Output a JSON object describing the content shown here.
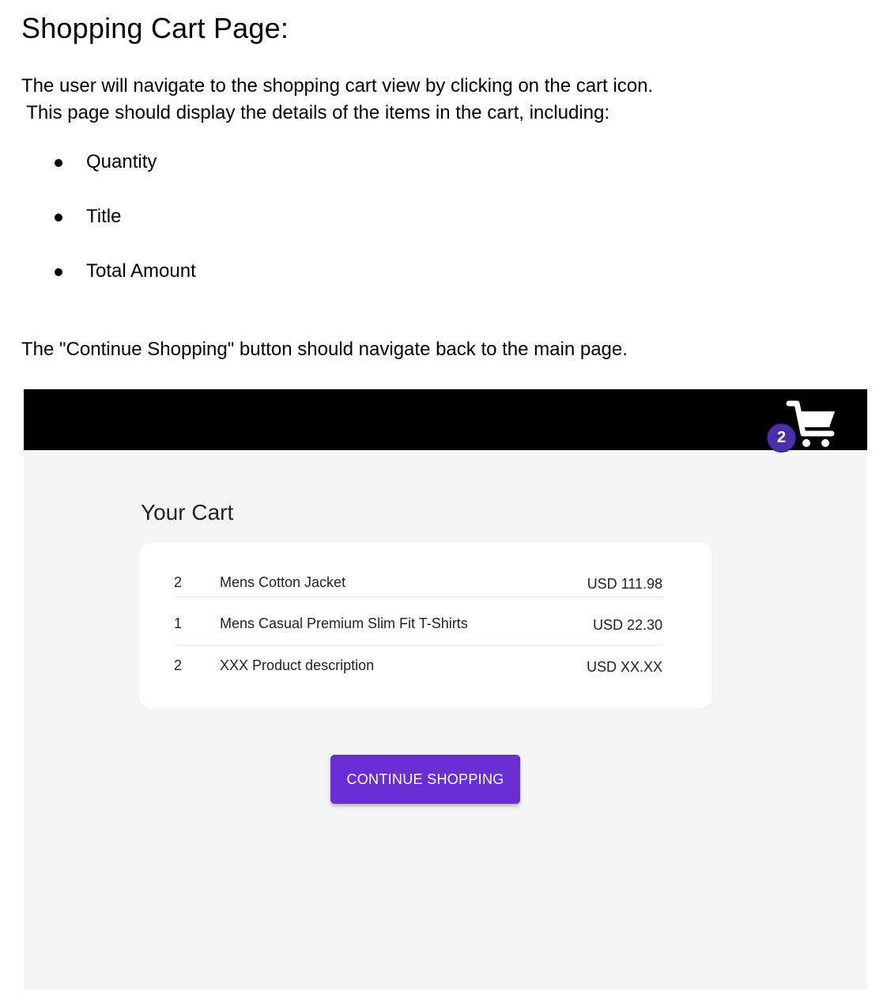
{
  "spec": {
    "title": "Shopping Cart Page:",
    "intro_line1": "The user will navigate to the shopping cart view by clicking on the cart icon.",
    "intro_line2": " This page should display the details of the items in the cart, including:",
    "list": [
      "Quantity",
      "Title",
      "Total Amount"
    ],
    "note": "The \"Continue Shopping\" button should navigate back to the main page."
  },
  "mockup": {
    "cart_icon": "shopping-cart-icon",
    "cart_badge_count": "2",
    "heading": "Your Cart",
    "items": [
      {
        "qty": "2",
        "title": "Mens Cotton Jacket",
        "amount": "USD 111.98"
      },
      {
        "qty": "1",
        "title": "Mens Casual Premium Slim Fit T-Shirts",
        "amount": "USD 22.30"
      },
      {
        "qty": "2",
        "title": "XXX Product description",
        "amount": "USD XX.XX"
      }
    ],
    "continue_label": "CONTINUE SHOPPING"
  },
  "colors": {
    "appbar": "#000000",
    "badge": "#4a2fa8",
    "button": "#6a2fd4",
    "page_background": "#f4f5f4",
    "card": "#ffffff"
  }
}
